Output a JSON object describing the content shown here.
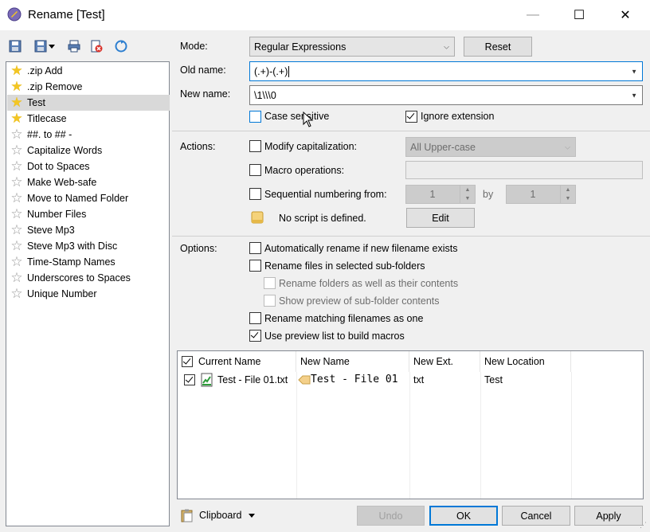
{
  "window": {
    "title": "Rename [Test]",
    "minimize": "—",
    "maximize": "☐",
    "close": "✕"
  },
  "presets": [
    {
      "label": ".zip Add",
      "icon": "gold-star-icon"
    },
    {
      "label": ".zip Remove",
      "icon": "gold-star-icon"
    },
    {
      "label": "Test",
      "icon": "gold-star-icon",
      "selected": true
    },
    {
      "label": "Titlecase",
      "icon": "gold-star-icon"
    },
    {
      "label": "##. to ## -",
      "icon": "hollow-star-icon"
    },
    {
      "label": "Capitalize Words",
      "icon": "hollow-star-icon"
    },
    {
      "label": "Dot to Spaces",
      "icon": "hollow-star-icon"
    },
    {
      "label": "Make Web-safe",
      "icon": "hollow-star-icon"
    },
    {
      "label": "Move to Named Folder",
      "icon": "hollow-star-icon"
    },
    {
      "label": "Number Files",
      "icon": "hollow-star-icon"
    },
    {
      "label": "Steve Mp3",
      "icon": "hollow-star-icon"
    },
    {
      "label": "Steve Mp3 with Disc",
      "icon": "hollow-star-icon"
    },
    {
      "label": "Time-Stamp Names",
      "icon": "hollow-star-icon"
    },
    {
      "label": "Underscores to Spaces",
      "icon": "hollow-star-icon"
    },
    {
      "label": "Unique Number",
      "icon": "hollow-star-icon"
    }
  ],
  "mode": {
    "label": "Mode:",
    "value": "Regular Expressions",
    "reset": "Reset"
  },
  "old_name": {
    "label": "Old name:",
    "value": "(.+)-(.+)"
  },
  "new_name": {
    "label": "New name:",
    "value": "\\1\\\\\\0"
  },
  "case_sensitive": {
    "label": "Case sensitive",
    "checked": false
  },
  "ignore_extension": {
    "label": "Ignore extension",
    "checked": true
  },
  "actions": {
    "label": "Actions:",
    "modify_cap": {
      "label": "Modify capitalization:",
      "checked": false,
      "value": "All Upper-case"
    },
    "macro_ops": {
      "label": "Macro operations:",
      "checked": false,
      "value": ""
    },
    "sequential": {
      "label": "Sequential numbering from:",
      "checked": false,
      "from": "1",
      "by_label": "by",
      "by": "1"
    },
    "script": {
      "text": "No script is defined.",
      "edit": "Edit"
    }
  },
  "options": {
    "label": "Options:",
    "items": [
      {
        "label": "Automatically rename if new filename exists",
        "checked": false,
        "disabled": false
      },
      {
        "label": "Rename files in selected sub-folders",
        "checked": false,
        "disabled": false
      },
      {
        "label": "Rename folders as well as their contents",
        "checked": false,
        "disabled": true
      },
      {
        "label": "Show preview of sub-folder contents",
        "checked": false,
        "disabled": true
      },
      {
        "label": "Rename matching filenames as one",
        "checked": false,
        "disabled": false
      },
      {
        "label": "Use preview list to build macros",
        "checked": true,
        "disabled": false
      }
    ]
  },
  "preview": {
    "columns": [
      "Current Name",
      "New Name",
      "New Ext.",
      "New Location"
    ],
    "rows": [
      {
        "checked": true,
        "current": "Test - File 01.txt",
        "new_name": "Test - File 01",
        "new_ext": "txt",
        "new_location": "Test"
      }
    ]
  },
  "footer": {
    "clipboard": "Clipboard",
    "undo": "Undo",
    "ok": "OK",
    "cancel": "Cancel",
    "apply": "Apply"
  },
  "colors": {
    "accent": "#0078d7",
    "star_gold": "#f3c623"
  }
}
